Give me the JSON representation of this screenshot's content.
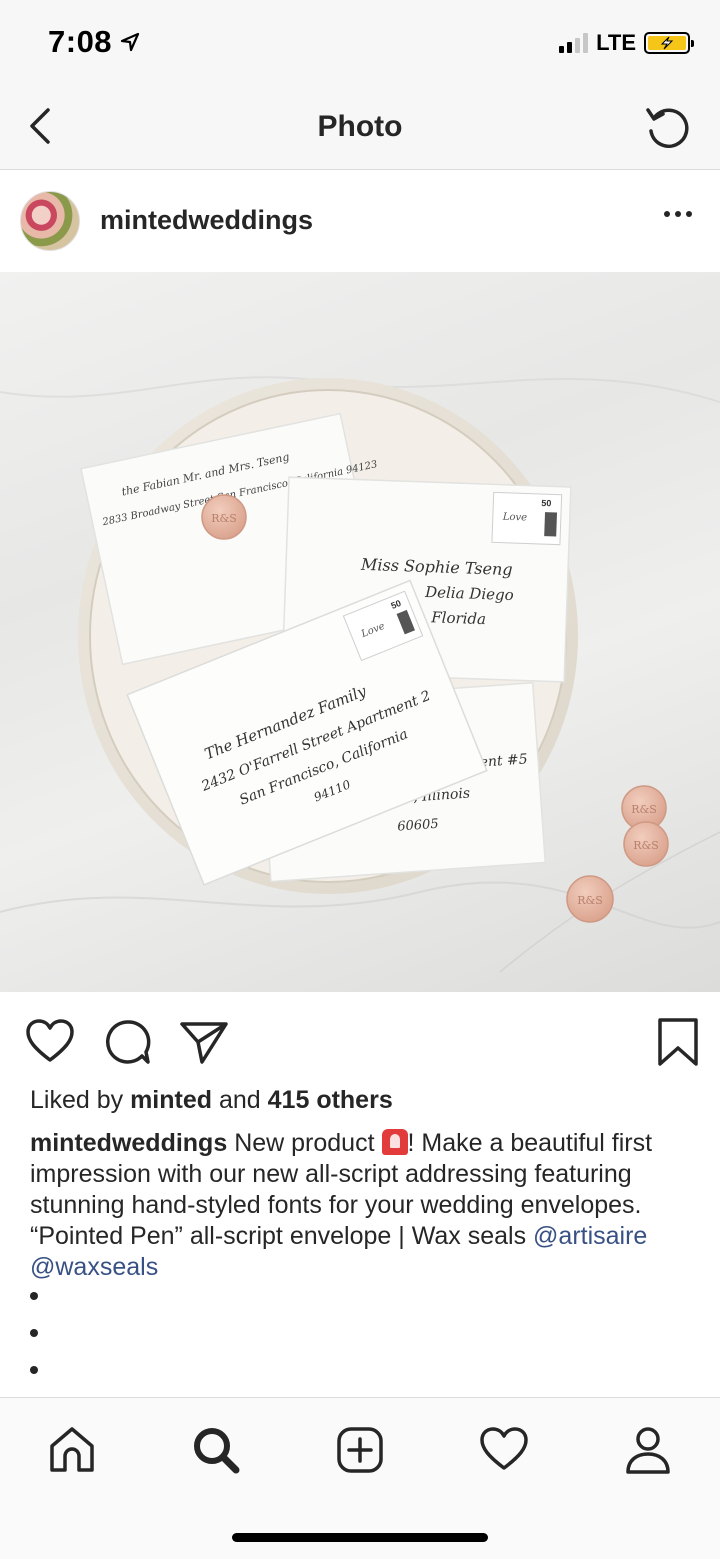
{
  "status_bar": {
    "time": "7:08",
    "network": "LTE"
  },
  "header": {
    "title": "Photo"
  },
  "post": {
    "username": "mintedweddings",
    "likes": {
      "prefix": "Liked by",
      "user": "minted",
      "middle": "and",
      "count": "415 others"
    },
    "caption": {
      "user": "mintedweddings",
      "text_1": "New product",
      "text_2": "! Make a beautiful first impression with our new all-script addressing featuring stunning hand-styled fonts for your wedding envelopes. “Pointed Pen” all-script envelope | Wax seals",
      "mention_1": "@artisaire",
      "mention_2": "@waxseals"
    }
  },
  "photo": {
    "envelope_1": {
      "line1": "the Fabian Mr. and Mrs. Tseng",
      "line2": "2833 Broadway Street  San Francisco, California 94123"
    },
    "envelope_2": {
      "line1": "Miss Sophie Tseng",
      "line2": "Delia Diego",
      "line3": "Florida"
    },
    "envelope_3": {
      "line1": "The Hernandez Family",
      "line2": "2432 O'Farrell Street Apartment 2",
      "line3": "San Francisco, California",
      "line4": "94110"
    },
    "envelope_4": {
      "line1": "Street Apartment #5",
      "line2": "Chicago, Illinois",
      "line3": "60605"
    },
    "stamp_value": "50",
    "stamp_word": "Love",
    "seal_monogram": "R&S"
  },
  "colors": {
    "mention": "#385185",
    "seal": "#e8b9a6",
    "envelope": "#fbfbfa"
  }
}
